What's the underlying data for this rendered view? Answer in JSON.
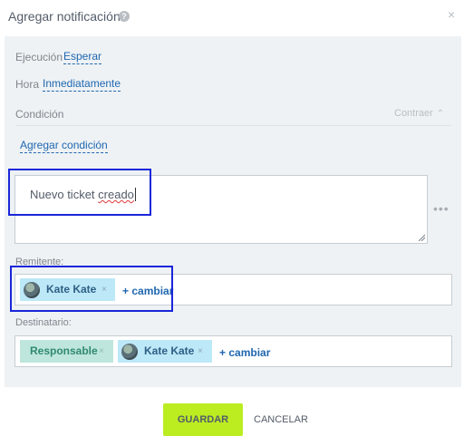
{
  "dialog": {
    "title": "Agregar notificación",
    "help_icon": "question-circle-icon",
    "help_glyph": "?",
    "close_icon": "close-icon",
    "close_glyph": "×"
  },
  "settings": {
    "execution_label": "Ejecución",
    "execution_value": "Esperar",
    "time_label": "Hora",
    "time_value": "Inmediatamente",
    "condition_label": "Condición",
    "collapse_label": "Contraer",
    "collapse_glyph": "⌃",
    "add_condition": "Agregar condición"
  },
  "message": {
    "text_before": "Nuevo ticket ",
    "text_misspelled": "creado",
    "more_glyph": "•••"
  },
  "sender": {
    "label": "Remitente:",
    "tags": [
      {
        "name": "Kate Kate",
        "remove": "×",
        "icon": "user-avatar"
      }
    ],
    "change": "+ cambiar"
  },
  "recipient": {
    "label": "Destinatario:",
    "tags": [
      {
        "name": "Responsable",
        "remove": "×"
      },
      {
        "name": "Kate Kate",
        "remove": "×",
        "icon": "user-avatar"
      }
    ],
    "change": "+ cambiar"
  },
  "footer": {
    "save": "GUARDAR",
    "cancel": "CANCELAR"
  },
  "colors": {
    "accent_save": "#bbed21",
    "link": "#2067b0",
    "highlight": "#1a26d9",
    "tag_user": "#bde8f7",
    "tag_role": "#bfe6dc"
  }
}
